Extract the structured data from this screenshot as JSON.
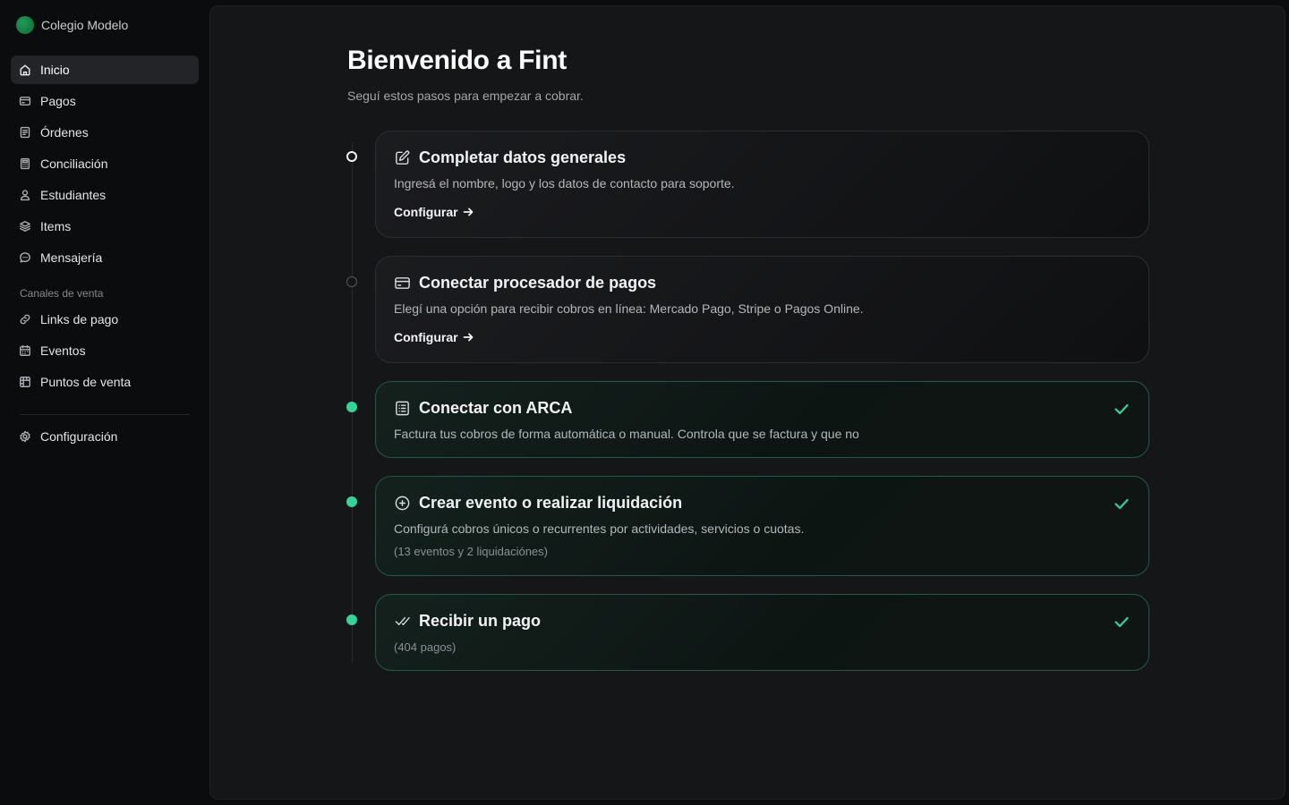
{
  "org": {
    "name": "Colegio Modelo"
  },
  "sidebar": {
    "items": [
      {
        "label": "Inicio",
        "icon": "home-icon",
        "active": true
      },
      {
        "label": "Pagos",
        "icon": "credit-card-icon"
      },
      {
        "label": "Órdenes",
        "icon": "document-icon"
      },
      {
        "label": "Conciliación",
        "icon": "calculator-icon"
      },
      {
        "label": "Estudiantes",
        "icon": "user-icon"
      },
      {
        "label": "Items",
        "icon": "layers-icon"
      },
      {
        "label": "Mensajería",
        "icon": "chat-bubble-icon"
      }
    ],
    "section_label": "Canales de venta",
    "channel_items": [
      {
        "label": "Links de pago",
        "icon": "link-icon"
      },
      {
        "label": "Eventos",
        "icon": "calendar-icon"
      },
      {
        "label": "Puntos de venta",
        "icon": "store-icon"
      }
    ],
    "settings": {
      "label": "Configuración",
      "icon": "gear-icon"
    }
  },
  "main": {
    "title": "Bienvenido a Fint",
    "subtitle": "Seguí estos pasos para empezar a cobrar.",
    "steps": [
      {
        "status": "current",
        "icon": "edit-icon",
        "title": "Completar datos generales",
        "description": "Ingresá el nombre, logo y los datos de contacto para soporte.",
        "action": "Configurar"
      },
      {
        "status": "pending",
        "icon": "credit-card-icon",
        "title": "Conectar procesador de pagos",
        "description": "Elegí una opción para recibir cobros en línea: Mercado Pago, Stripe o Pagos Online.",
        "action": "Configurar"
      },
      {
        "status": "done",
        "icon": "list-document-icon",
        "title": "Conectar con ARCA",
        "description": "Factura tus cobros de forma automática o manual. Controla que se factura y que no"
      },
      {
        "status": "done",
        "icon": "plus-circle-icon",
        "title": "Crear evento o realizar liquidación",
        "description": "Configurá cobros únicos o recurrentes por actividades, servicios o cuotas.",
        "meta": "(13 eventos y 2 liquidaciónes)"
      },
      {
        "status": "done",
        "icon": "double-check-icon",
        "title": "Recibir un pago",
        "meta": "(404 pagos)"
      }
    ]
  },
  "colors": {
    "accent": "#34d399",
    "background": "#0b0c0d",
    "panel": "#151618"
  }
}
